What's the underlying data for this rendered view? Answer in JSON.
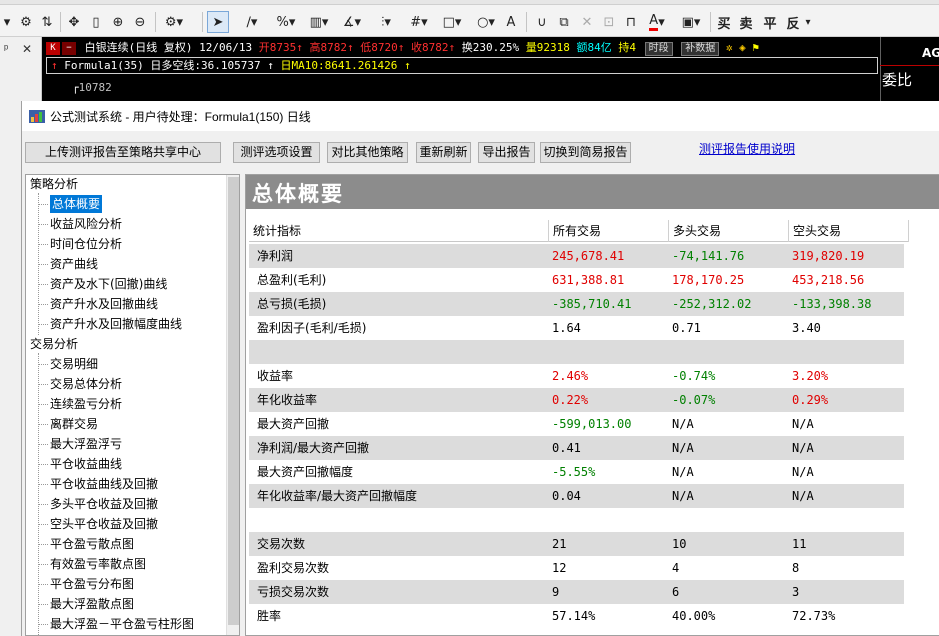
{
  "toolbar": {
    "icons": [
      "filter-icon",
      "settings-icon",
      "swap-icon",
      "crosshair-icon",
      "ruler-icon",
      "zoom-in-icon",
      "zoom-out-icon",
      "gear-icon",
      "pointer-icon",
      "line-icon",
      "percent-icon",
      "grid-icon",
      "angle-icon",
      "levels-icon",
      "hash-icon",
      "rectangle-icon",
      "circle-icon",
      "text-icon",
      "magnet-icon",
      "copy-icon",
      "delete-icon",
      "lock-open-icon",
      "lock-icon",
      "color-icon",
      "save-icon"
    ],
    "buy_label": "买",
    "sell_label": "卖",
    "flat_label": "平",
    "reverse_label": "反"
  },
  "chart": {
    "symbol_line": "白银连续(日线 复权) 12/06/13",
    "open": "开8735↑",
    "high": "高8782↑",
    "low": "低8720↑",
    "close": "收8782↑",
    "turnover": "换230.25%",
    "volume": "量92318",
    "amount": "额84亿",
    "position": "持4",
    "period_btn": "时段",
    "data_btn": "补数据",
    "formula_line": "Formula1(35)",
    "formula_ls": "日多空线:36.105737",
    "formula_ma": "日MA10:8641.261426",
    "price_label": "10782",
    "right_code": "AG",
    "right_label": "委比",
    "colors": {
      "red": "#ff3030",
      "yellow": "#ffff00",
      "white": "#ffffff",
      "green": "#00ff00"
    }
  },
  "dialog": {
    "title": "公式测试系统 - 用户待处理：Formula1(150) 日线",
    "buttons": {
      "upload": "上传测评报告至策略共享中心",
      "options": "测评选项设置",
      "compare": "对比其他策略",
      "refresh": "重新刷新",
      "export": "导出报告",
      "simple": "切换到简易报告"
    },
    "help_link": "测评报告使用说明"
  },
  "tree": {
    "categories": [
      {
        "label": "策略分析",
        "children": [
          "总体概要",
          "收益风险分析",
          "时间仓位分析",
          "资产曲线",
          "资产及水下(回撤)曲线",
          "资产升水及回撤曲线",
          "资产升水及回撤幅度曲线"
        ]
      },
      {
        "label": "交易分析",
        "children": [
          "交易明细",
          "交易总体分析",
          "连续盈亏分析",
          "离群交易",
          "最大浮盈浮亏",
          "平仓收益曲线",
          "平仓收益曲线及回撤",
          "多头平仓收益及回撤",
          "空头平仓收益及回撤",
          "平仓盈亏散点图",
          "有效盈亏率散点图",
          "平仓盈亏分布图",
          "最大浮盈散点图",
          "最大浮盈－平仓盈亏柱形图"
        ]
      }
    ],
    "selected": "总体概要"
  },
  "report": {
    "banner": "总体概要",
    "headers": [
      "统计指标",
      "所有交易",
      "多头交易",
      "空头交易"
    ],
    "rows": [
      {
        "label": "净利润",
        "all": "245,678.41",
        "long": "-74,141.76",
        "short": "319,820.19",
        "colors": [
          "red",
          "green",
          "red"
        ]
      },
      {
        "label": "总盈利(毛利)",
        "all": "631,388.81",
        "long": "178,170.25",
        "short": "453,218.56",
        "colors": [
          "red",
          "red",
          "red"
        ]
      },
      {
        "label": "总亏损(毛损)",
        "all": "-385,710.41",
        "long": "-252,312.02",
        "short": "-133,398.38",
        "colors": [
          "green",
          "green",
          "green"
        ]
      },
      {
        "label": "盈利因子(毛利/毛损)",
        "all": "1.64",
        "long": "0.71",
        "short": "3.40",
        "colors": [
          "black",
          "black",
          "black"
        ]
      },
      {
        "label": "",
        "all": "",
        "long": "",
        "short": "",
        "colors": [
          "black",
          "black",
          "black"
        ]
      },
      {
        "label": "收益率",
        "all": "2.46%",
        "long": "-0.74%",
        "short": "3.20%",
        "colors": [
          "red",
          "green",
          "red"
        ]
      },
      {
        "label": "年化收益率",
        "all": "0.22%",
        "long": "-0.07%",
        "short": "0.29%",
        "colors": [
          "red",
          "green",
          "red"
        ]
      },
      {
        "label": "最大资产回撤",
        "all": "-599,013.00",
        "long": "N/A",
        "short": "N/A",
        "colors": [
          "green",
          "black",
          "black"
        ]
      },
      {
        "label": "净利润/最大资产回撤",
        "all": "0.41",
        "long": "N/A",
        "short": "N/A",
        "colors": [
          "black",
          "black",
          "black"
        ]
      },
      {
        "label": "最大资产回撤幅度",
        "all": "-5.55%",
        "long": "N/A",
        "short": "N/A",
        "colors": [
          "green",
          "black",
          "black"
        ]
      },
      {
        "label": "年化收益率/最大资产回撤幅度",
        "all": "0.04",
        "long": "N/A",
        "short": "N/A",
        "colors": [
          "black",
          "black",
          "black"
        ]
      },
      {
        "label": "",
        "all": "",
        "long": "",
        "short": "",
        "colors": [
          "black",
          "black",
          "black"
        ]
      },
      {
        "label": "交易次数",
        "all": "21",
        "long": "10",
        "short": "11",
        "colors": [
          "black",
          "black",
          "black"
        ]
      },
      {
        "label": "盈利交易次数",
        "all": "12",
        "long": "4",
        "short": "8",
        "colors": [
          "black",
          "black",
          "black"
        ]
      },
      {
        "label": "亏损交易次数",
        "all": "9",
        "long": "6",
        "short": "3",
        "colors": [
          "black",
          "black",
          "black"
        ]
      },
      {
        "label": "胜率",
        "all": "57.14%",
        "long": "40.00%",
        "short": "72.73%",
        "colors": [
          "black",
          "black",
          "black"
        ]
      }
    ]
  }
}
